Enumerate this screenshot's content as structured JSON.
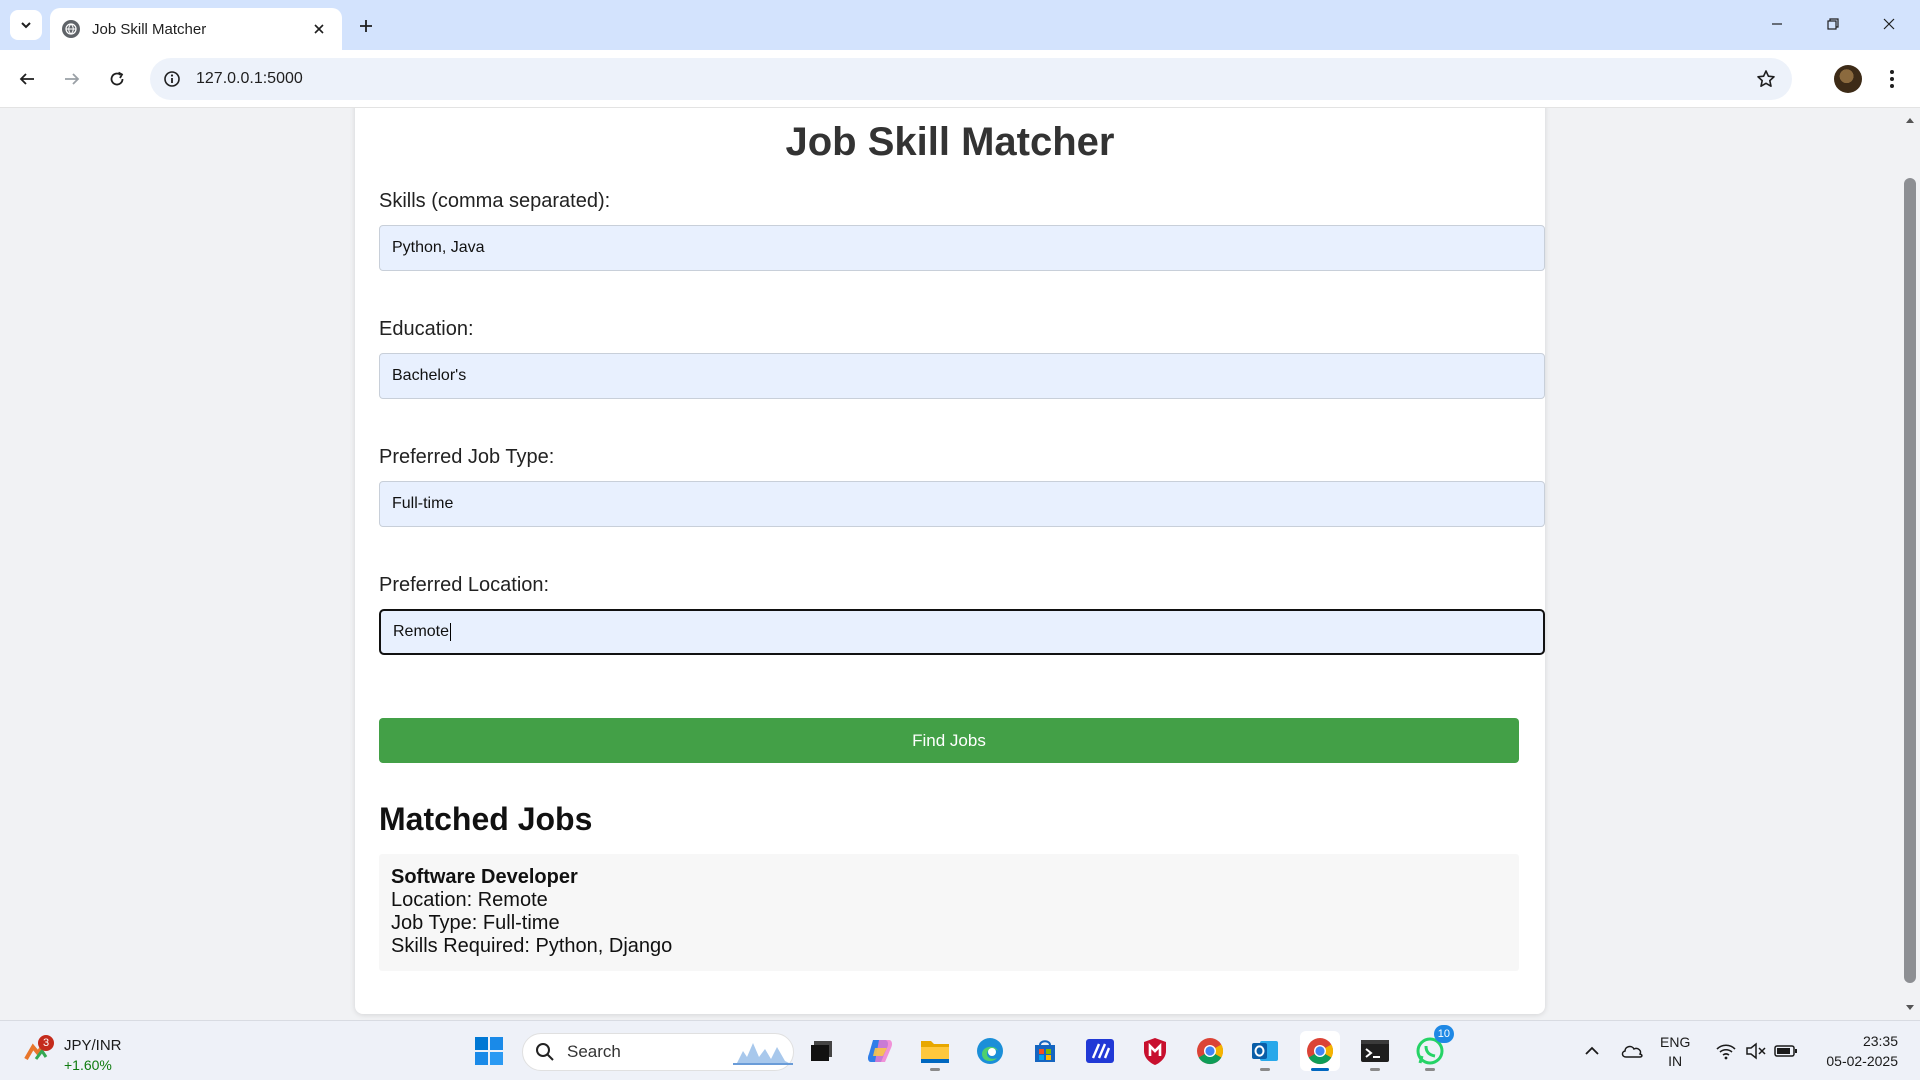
{
  "browser": {
    "tab_title": "Job Skill Matcher",
    "url": "127.0.0.1:5000"
  },
  "page": {
    "title": "Job Skill Matcher",
    "fields": [
      {
        "label": "Skills (comma separated):",
        "value": "Python, Java"
      },
      {
        "label": "Education:",
        "value": "Bachelor's"
      },
      {
        "label": "Preferred Job Type:",
        "value": "Full-time"
      },
      {
        "label": "Preferred Location:",
        "value": "Remote"
      }
    ],
    "submit_label": "Find Jobs",
    "results_heading": "Matched Jobs",
    "jobs": [
      {
        "title": "Software Developer",
        "location": "Location: Remote",
        "job_type": "Job Type: Full-time",
        "skills": "Skills Required: Python, Django"
      }
    ]
  },
  "taskbar": {
    "weather": {
      "pair": "JPY/INR",
      "change": "+1.60%",
      "badge": "3"
    },
    "search_placeholder": "Search",
    "whatsapp_badge": "10",
    "lang_line1": "ENG",
    "lang_line2": "IN",
    "time": "23:35",
    "date": "05-02-2025"
  },
  "colors": {
    "accent_green": "#43a047",
    "input_bg": "#e8f0fe",
    "tab_strip": "#d3e3fd"
  }
}
